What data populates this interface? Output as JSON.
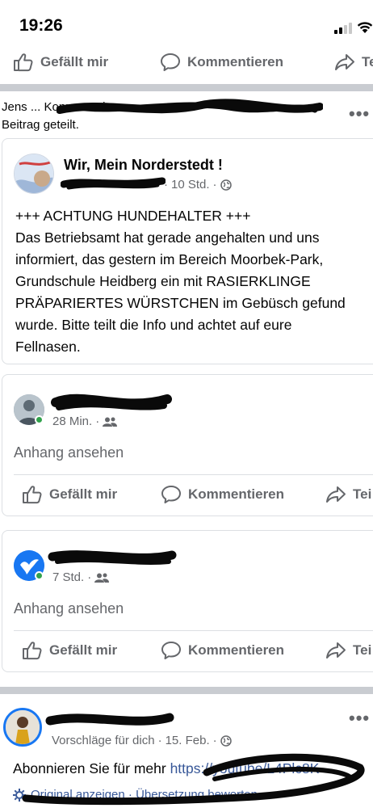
{
  "status_bar": {
    "time": "19:26"
  },
  "top_actions": {
    "like": "Gefällt mir",
    "comment": "Kommentieren",
    "share": "Te"
  },
  "shared_post": {
    "header_line_1": "Jens ... Konner... einen",
    "header_line_2": "Beitrag geteilt.",
    "more": "•••",
    "original": {
      "page_name": "Wir, Mein Norderstedt !",
      "time": "10 Std.",
      "body": "+++ ACHTUNG HUNDEHALTER +++\nDas Betriebsamt hat gerade angehalten und uns\ninformiert, das gestern im Bereich Moorbek-Park,\nGrundschule Heidberg ein mit RASIERKLINGE\nPRÄPARIERTES WÜRSTCHEN im Gebüsch gefund\nwurde. Bitte teilt die Info und achtet auf eure\nFellnasen."
    }
  },
  "comment_share_1": {
    "time": "28 Min.",
    "attachment_link": "Anhang ansehen",
    "actions": {
      "like": "Gefällt mir",
      "comment": "Kommentieren",
      "share": "Tei"
    }
  },
  "comment_share_2": {
    "time": "7 Std.",
    "attachment_link": "Anhang ansehen",
    "actions": {
      "like": "Gefällt mir",
      "comment": "Kommentieren",
      "share": "Tei"
    }
  },
  "suggested_post": {
    "label": "Vorschläge für dich",
    "date": "15. Feb.",
    "more": "•••",
    "body_prefix": "Abonnieren Sie für mehr ",
    "body_link": "https://youtube/L4Plc8K",
    "footer": "Original anzeigen · Übersetzung bewerten"
  },
  "colors": {
    "icon_gray": "#65676b",
    "divider": "#c9ccd1",
    "online": "#31a24c",
    "link": "#385898"
  }
}
